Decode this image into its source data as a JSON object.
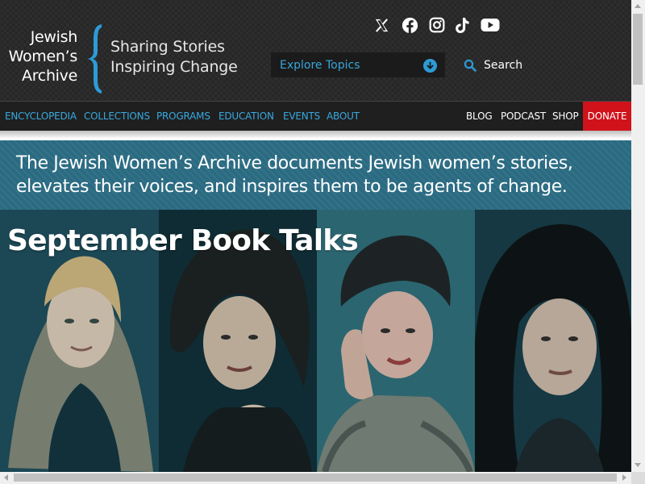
{
  "logo": {
    "line1": "Jewish",
    "line2": "Women’s",
    "line3": "Archive"
  },
  "tagline": {
    "line1": "Sharing Stories",
    "line2": "Inspiring Change"
  },
  "social_icons": [
    "x-icon",
    "facebook-icon",
    "instagram-icon",
    "tiktok-icon",
    "youtube-icon"
  ],
  "topics": {
    "label": "Explore Topics"
  },
  "search": {
    "label": "Search"
  },
  "nav": {
    "primary": [
      "ENCYCLOPEDIA",
      "COLLECTIONS",
      "PROGRAMS",
      "EDUCATION",
      "EVENTS",
      "ABOUT"
    ],
    "utility": [
      "BLOG",
      "PODCAST",
      "SHOP"
    ],
    "donate": "DONATE"
  },
  "mission": {
    "text": "The Jewish Women’s Archive documents Jewish women’s stories, elevates their voices, and inspires them to be agents of change."
  },
  "hero": {
    "title": "September Book Talks"
  },
  "colors": {
    "header_bg": "#262626",
    "nav_link": "#39a9e0",
    "accent_blue": "#2d9bd6",
    "donate_red": "#d0121b",
    "mission_bg": "#2a6b82",
    "hero_tint": "#1d4a57"
  }
}
